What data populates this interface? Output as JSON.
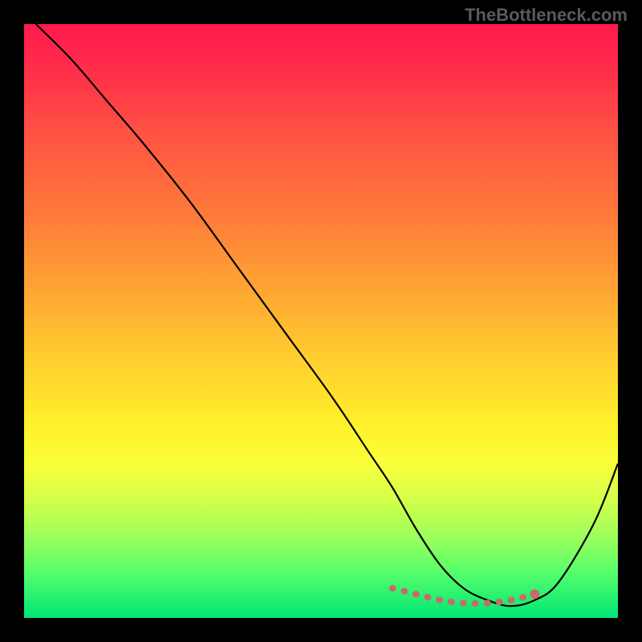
{
  "watermark": "TheBottleneck.com",
  "chart_data": {
    "type": "line",
    "title": "",
    "xlabel": "",
    "ylabel": "",
    "xlim": [
      0,
      100
    ],
    "ylim": [
      0,
      100
    ],
    "grid": false,
    "legend": false,
    "background_gradient": {
      "top": "#ff1a4d",
      "mid": "#ffd02e",
      "bottom": "#00e676"
    },
    "series": [
      {
        "name": "bottleneck-curve",
        "color": "#000000",
        "x": [
          2,
          8,
          14,
          20,
          28,
          36,
          44,
          52,
          58,
          62,
          66,
          70,
          74,
          78,
          82,
          86,
          90,
          96,
          100
        ],
        "y": [
          100,
          94,
          87,
          80,
          70,
          59,
          48,
          37,
          28,
          22,
          15,
          9,
          5,
          3,
          2,
          3,
          6,
          16,
          26
        ]
      }
    ],
    "highlight": {
      "name": "optimal-flat-region",
      "color": "#c96a6a",
      "x": [
        62,
        66,
        70,
        74,
        78,
        82,
        86
      ],
      "y": [
        5,
        4,
        3,
        2.5,
        2.5,
        3,
        4
      ]
    }
  }
}
